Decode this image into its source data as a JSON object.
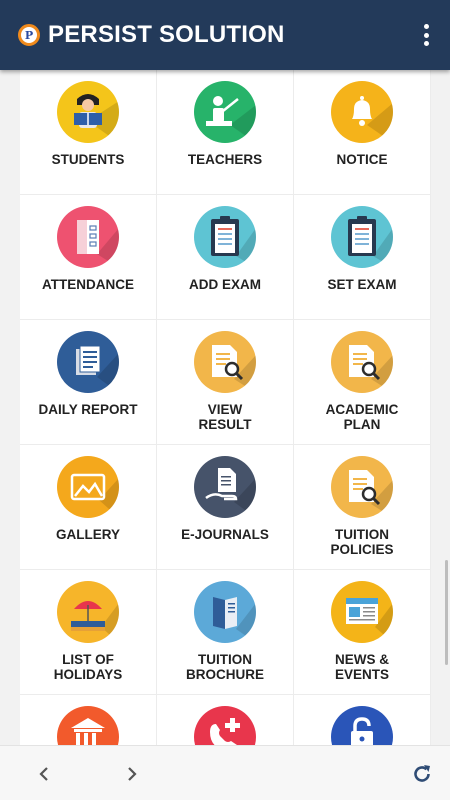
{
  "app": {
    "title": "PERSIST SOLUTION",
    "logo_letter": "P"
  },
  "tiles": [
    {
      "label": "STUDENTS",
      "icon": "student-reading-icon",
      "color": "#f4c51a"
    },
    {
      "label": "TEACHERS",
      "icon": "teacher-board-icon",
      "color": "#27b36a"
    },
    {
      "label": "NOTICE",
      "icon": "bell-icon",
      "color": "#f5b31a"
    },
    {
      "label": "ATTENDANCE",
      "icon": "attendance-sheet-icon",
      "color": "#ee5270"
    },
    {
      "label": "ADD EXAM",
      "icon": "clipboard-icon",
      "color": "#5ec4d3"
    },
    {
      "label": "SET EXAM",
      "icon": "clipboard-icon",
      "color": "#5ec4d3"
    },
    {
      "label": "DAILY REPORT",
      "icon": "report-pages-icon",
      "color": "#2f5d98"
    },
    {
      "label": "VIEW\nRESULT",
      "icon": "document-search-icon",
      "color": "#f2b64a"
    },
    {
      "label": "ACADEMIC\nPLAN",
      "icon": "document-search-icon",
      "color": "#f2b64a"
    },
    {
      "label": "GALLERY",
      "icon": "picture-icon",
      "color": "#f4a81c"
    },
    {
      "label": "E-JOURNALS",
      "icon": "hand-document-icon",
      "color": "#46536a"
    },
    {
      "label": "TUITION\nPOLICIES",
      "icon": "document-search-icon",
      "color": "#f2b64a"
    },
    {
      "label": "LIST OF\nHOLIDAYS",
      "icon": "beach-umbrella-icon",
      "color": "#f6b52a"
    },
    {
      "label": "TUITION\nBROCHURE",
      "icon": "brochure-icon",
      "color": "#5ca9d8"
    },
    {
      "label": "NEWS &\nEVENTS",
      "icon": "newspaper-icon",
      "color": "#f4b418"
    },
    {
      "label": "",
      "icon": "building-icon",
      "color": "#f25a2c"
    },
    {
      "label": "",
      "icon": "phone-medical-icon",
      "color": "#e8364c"
    },
    {
      "label": "",
      "icon": "lock-icon",
      "color": "#2a55b8"
    }
  ],
  "nav": {
    "back_icon": "chevron-left-icon",
    "forward_icon": "chevron-right-icon",
    "refresh_icon": "refresh-icon"
  }
}
